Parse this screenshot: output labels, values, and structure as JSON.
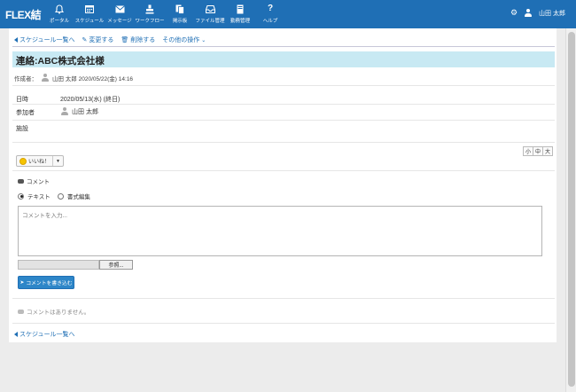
{
  "app": {
    "logo": "FLEX結"
  },
  "nav": [
    {
      "label": "ポータル",
      "icon": "bell-icon",
      "glyph": "🔔"
    },
    {
      "label": "スケジュール",
      "icon": "calendar-icon",
      "glyph": "▦"
    },
    {
      "label": "メッセージ",
      "icon": "envelope-icon",
      "glyph": "✉"
    },
    {
      "label": "ワークフロー",
      "icon": "stamp-icon",
      "glyph": "⊥"
    },
    {
      "label": "掲示板",
      "icon": "documents-icon",
      "glyph": "▤"
    },
    {
      "label": "ファイル管理",
      "icon": "inbox-icon",
      "glyph": "⬓"
    },
    {
      "label": "勤務管理",
      "icon": "timecard-icon",
      "glyph": "▯"
    },
    {
      "label": "ヘルプ",
      "icon": "help-icon",
      "glyph": "?"
    }
  ],
  "header": {
    "username": "山田 太郎"
  },
  "actions": {
    "back": "スケジュール一覧へ",
    "edit": "変更する",
    "delete": "削除する",
    "other": "その他の操作"
  },
  "schedule": {
    "title": "連絡:ABC株式会社様",
    "creator_label": "作成者：",
    "creator": "山田 太郎 2020/05/22(金) 14:16",
    "fields": {
      "datetime_label": "日時",
      "datetime_value": "2020/05/13(水) (終日)",
      "participants_label": "参加者",
      "participant": "山田 太郎",
      "facility_label": "施設"
    }
  },
  "font_sizes": [
    "小",
    "中",
    "大"
  ],
  "like": {
    "label": "いいね！"
  },
  "comment": {
    "header": "コメント",
    "mode_text": "テキスト",
    "mode_rich": "書式編集",
    "placeholder": "コメントを入力...",
    "browse": "参照...",
    "submit": "コメントを書き込む",
    "empty": "コメントはありません。"
  },
  "footer": {
    "back": "スケジュール一覧へ"
  },
  "colors": {
    "accent": "#1f6fb5",
    "title_bg": "#c8e9f3",
    "button": "#2d86c8"
  }
}
